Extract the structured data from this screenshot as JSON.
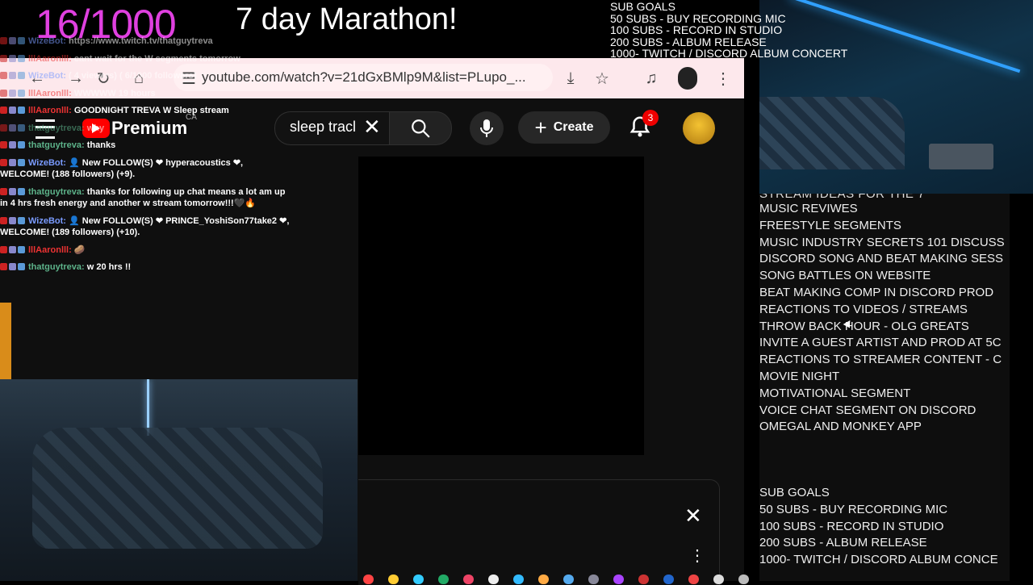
{
  "overlay": {
    "counter": "16/1000",
    "marathon": "7 day Marathon!",
    "sub_goals_top": [
      "SUB GOALS",
      "50 SUBS - BUY RECORDING MIC",
      "100 SUBS - RECORD IN STUDIO",
      "200 SUBS - ALBUM RELEASE",
      "1000- TWITCH / DISCORD ALBUM CONCERT"
    ]
  },
  "browser": {
    "url": "youtube.com/watch?v=21dGxBMlp9M&list=PLupo_...",
    "icons": [
      "back-icon",
      "forward-icon",
      "reload-icon",
      "home-icon",
      "download-icon",
      "star-icon",
      "media-icon",
      "profile-icon",
      "menu-icon"
    ]
  },
  "youtube": {
    "brand": "Premium",
    "region": "CA",
    "search_value": "sleep tracl",
    "create_label": "Create",
    "notification_count": "3"
  },
  "chat": [
    {
      "user": "WizeBot:",
      "text": "https://www.twitch.tv/thatguytreva",
      "color": "#7a9bff",
      "faded": true
    },
    {
      "user": "lllAaronlll:",
      "text": "cant wait for the W segments tomorrow",
      "color": "#e33",
      "faded": true
    },
    {
      "user": "WizeBot:",
      "text": "( 4 viewers) ( 6/1000 followers)",
      "color": "#7a9bff",
      "faded": true
    },
    {
      "user": "lllAaronlll:",
      "text": "WWWWW 19 hours",
      "color": "#e33",
      "faded": true
    },
    {
      "user": "lllAaronlll:",
      "text": "GOODNIGHT TREVA W Sleep stream",
      "color": "#e33",
      "faded": false
    },
    {
      "user": "thatguytreva:",
      "text": "why",
      "color": "#5db38a",
      "faded": true
    },
    {
      "user": "thatguytreva:",
      "text": "thanks",
      "color": "#5db38a",
      "faded": false
    },
    {
      "user": "WizeBot:",
      "text": "👤 New FOLLOW(S) ❤ hyperacoustics ❤, WELCOME! (188 followers) (+9).",
      "color": "#7a9bff",
      "faded": false
    },
    {
      "user": "thatguytreva:",
      "text": "thanks for following up chat means a lot am up in 4 hrs fresh energy and another w stream tomorrow!!!🖤🔥",
      "color": "#5db38a",
      "faded": false
    },
    {
      "user": "WizeBot:",
      "text": "👤 New FOLLOW(S) ❤ PRINCE_YoshiSon77take2 ❤, WELCOME! (189 followers) (+10).",
      "color": "#7a9bff",
      "faded": false
    },
    {
      "user": "lllAaronlll:",
      "text": "🥔",
      "color": "#e33",
      "faded": false
    },
    {
      "user": "thatguytreva:",
      "text": "w 20 hrs !!",
      "color": "#5db38a",
      "faded": false
    }
  ],
  "ideas": {
    "title": "STREAM IDEAS FOR THE 7",
    "items": [
      "MUSIC REVIWES",
      "FREESTYLE SEGMENTS",
      "MUSIC INDUSTRY SECRETS 101 DISCUSS",
      "DISCORD SONG AND BEAT MAKING SESS",
      "SONG BATTLES ON WEBSITE",
      "BEAT MAKING COMP IN  DISCORD PROD",
      "REACTIONS TO VIDEOS / STREAMS",
      "THROW BACK HOUR - OLG GREATS",
      "INVITE A GUEST ARTIST AND PROD AT 5C",
      "REACTIONS TO STREAMER CONTENT - C",
      "MOVIE NIGHT",
      "MOTIVATIONAL SEGMENT",
      "VOICE CHAT SEGMENT ON DISCORD",
      "OMEGAL AND MONKEY APP"
    ],
    "sub_goals": [
      "SUB GOALS",
      "50 SUBS - BUY RECORDING MIC",
      "100 SUBS - RECORD IN STUDIO",
      "200 SUBS - ALBUM RELEASE",
      "1000- TWITCH / DISCORD ALBUM CONCE"
    ]
  },
  "dock_colors": [
    "#f44",
    "#fc3",
    "#3cf",
    "#2a6",
    "#e46",
    "#eee",
    "#3bf",
    "#fa4",
    "#5ae",
    "#889",
    "#a4f",
    "#c33",
    "#26c",
    "#e44",
    "#ddd",
    "#bbb"
  ]
}
